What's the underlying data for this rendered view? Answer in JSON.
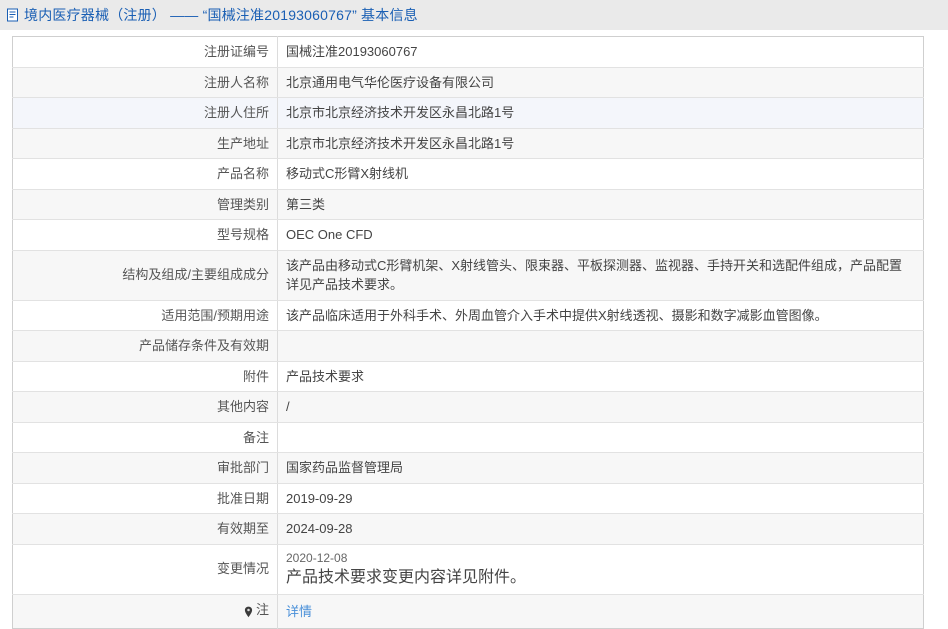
{
  "header": {
    "icon": "document-icon",
    "text_prefix": "境内医疗器械（注册）",
    "text_dash": "——",
    "text_quoted": "“国械注准20193060767”",
    "text_suffix": "基本信息",
    "full_title": "境内医疗器械（注册） —— “国械注准20193060767” 基本信息",
    "accent_color": "#1a5fb4",
    "band_color": "#eaeaea"
  },
  "table": {
    "rows": [
      {
        "label": "注册证编号",
        "value": "国械注准20193060767",
        "style": "plain"
      },
      {
        "label": "注册人名称",
        "value": "北京通用电气华伦医疗设备有限公司",
        "style": "alt"
      },
      {
        "label": "注册人住所",
        "value": "北京市北京经济技术开发区永昌北路1号",
        "style": "hover"
      },
      {
        "label": "生产地址",
        "value": "北京市北京经济技术开发区永昌北路1号",
        "style": "alt"
      },
      {
        "label": "产品名称",
        "value": "移动式C形臂X射线机",
        "style": "plain"
      },
      {
        "label": "管理类别",
        "value": "第三类",
        "style": "alt"
      },
      {
        "label": "型号规格",
        "value": "OEC One CFD",
        "style": "plain"
      },
      {
        "label": "结构及组成/主要组成成分",
        "value": "该产品由移动式C形臂机架、X射线管头、限束器、平板探测器、监视器、手持开关和选配件组成，产品配置详见产品技术要求。",
        "style": "alt"
      },
      {
        "label": "适用范围/预期用途",
        "value": "该产品临床适用于外科手术、外周血管介入手术中提供X射线透视、摄影和数字减影血管图像。",
        "style": "plain"
      },
      {
        "label": "产品储存条件及有效期",
        "value": "",
        "style": "alt"
      },
      {
        "label": "附件",
        "value": "产品技术要求",
        "style": "plain"
      },
      {
        "label": "其他内容",
        "value": "/",
        "style": "alt"
      },
      {
        "label": "备注",
        "value": "",
        "style": "plain"
      },
      {
        "label": "审批部门",
        "value": "国家药品监督管理局",
        "style": "alt"
      },
      {
        "label": "批准日期",
        "value": "2019-09-29",
        "style": "plain"
      },
      {
        "label": "有效期至",
        "value": "2024-09-28",
        "style": "alt"
      }
    ],
    "change_row": {
      "label": "变更情况",
      "date": "2020-12-08",
      "text": "产品技术要求变更内容详见附件。",
      "style": "plain"
    },
    "note_row": {
      "icon": "pin-marker-icon",
      "label": "注",
      "link_text": "详情",
      "link_color": "#4a90d9",
      "style": "alt"
    }
  }
}
